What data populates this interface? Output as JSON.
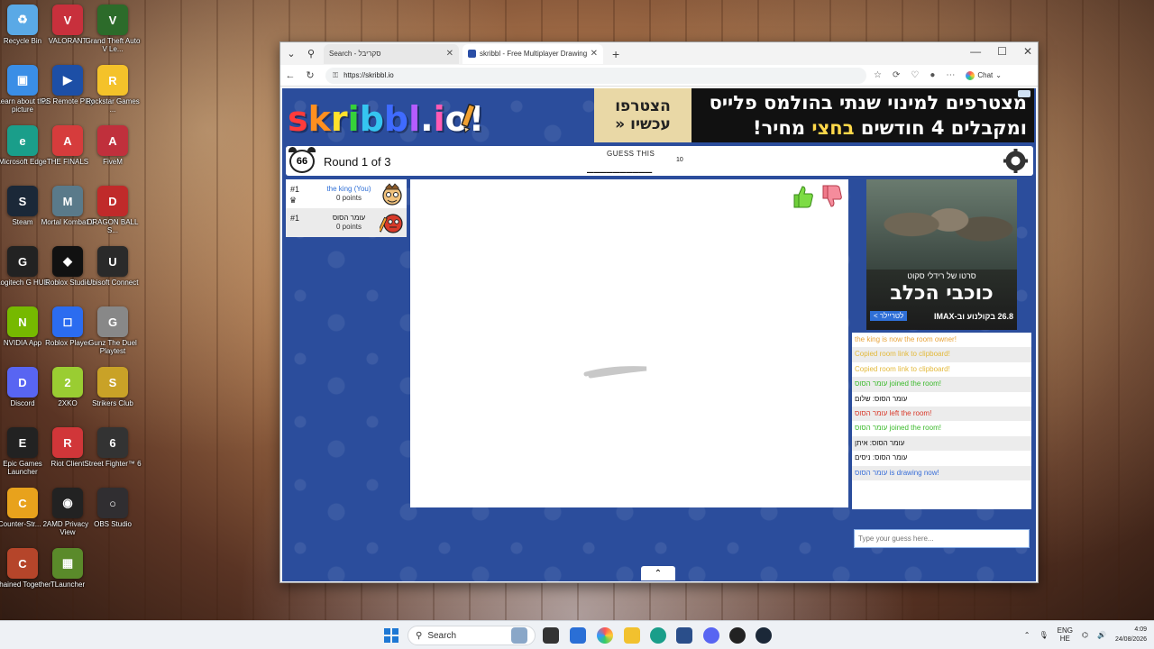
{
  "desktop": {
    "icons": [
      {
        "label": "Recycle Bin",
        "icon": "recycle-bin-icon",
        "color": "#5aa9e6",
        "glyph": "♻"
      },
      {
        "label": "VALORANT",
        "icon": "valorant-icon",
        "color": "#c8303c",
        "glyph": "V"
      },
      {
        "label": "Grand Theft Auto V Le...",
        "icon": "gta-icon",
        "color": "#2c6b2a",
        "glyph": "V"
      },
      {
        "label": "Learn about this picture",
        "icon": "learn-picture-icon",
        "color": "#3a8ee6",
        "glyph": "▣"
      },
      {
        "label": "PS Remote Play",
        "icon": "ps-remote-play-icon",
        "color": "#1d4fa6",
        "glyph": "▶"
      },
      {
        "label": "Rockstar Games ...",
        "icon": "rockstar-icon",
        "color": "#f4c22a",
        "glyph": "R"
      },
      {
        "label": "Microsoft Edge",
        "icon": "edge-icon",
        "color": "#1a9e8a",
        "glyph": "e"
      },
      {
        "label": "THE FINALS",
        "icon": "the-finals-icon",
        "color": "#d63c3c",
        "glyph": "A"
      },
      {
        "label": "FiveM",
        "icon": "fivem-icon",
        "color": "#c0303c",
        "glyph": "A"
      },
      {
        "label": "Steam",
        "icon": "steam-icon",
        "color": "#1b2838",
        "glyph": "S"
      },
      {
        "label": "Mortal Kombat 1",
        "icon": "mortal-kombat-icon",
        "color": "#5a7a8a",
        "glyph": "M"
      },
      {
        "label": "DRAGON BALL S...",
        "icon": "dragon-ball-icon",
        "color": "#c02a2a",
        "glyph": "D"
      },
      {
        "label": "Logitech G HUB",
        "icon": "logitech-icon",
        "color": "#222222",
        "glyph": "G"
      },
      {
        "label": "Roblox Studio",
        "icon": "roblox-studio-icon",
        "color": "#111111",
        "glyph": "◆"
      },
      {
        "label": "Ubisoft Connect",
        "icon": "ubisoft-icon",
        "color": "#2a2a2a",
        "glyph": "U"
      },
      {
        "label": "NVIDIA App",
        "icon": "nvidia-icon",
        "color": "#76b900",
        "glyph": "N"
      },
      {
        "label": "Roblox Player",
        "icon": "roblox-player-icon",
        "color": "#2b6cf0",
        "glyph": "◻"
      },
      {
        "label": "Gunz The Duel Playtest",
        "icon": "gunz-icon",
        "color": "#888888",
        "glyph": "G"
      },
      {
        "label": "Discord",
        "icon": "discord-icon",
        "color": "#5865f2",
        "glyph": "D"
      },
      {
        "label": "2XKO",
        "icon": "2xko-icon",
        "color": "#9acd32",
        "glyph": "2"
      },
      {
        "label": "Strikers Club",
        "icon": "strikers-club-icon",
        "color": "#c9a227",
        "glyph": "S"
      },
      {
        "label": "Epic Games Launcher",
        "icon": "epic-games-icon",
        "color": "#222222",
        "glyph": "E"
      },
      {
        "label": "Riot Client",
        "icon": "riot-client-icon",
        "color": "#d13639",
        "glyph": "R"
      },
      {
        "label": "Street Fighter™ 6",
        "icon": "street-fighter-icon",
        "color": "#333333",
        "glyph": "6"
      },
      {
        "label": "Counter-Str... 2",
        "icon": "counter-strike-icon",
        "color": "#e8a21c",
        "glyph": "C"
      },
      {
        "label": "AMD Privacy View",
        "icon": "amd-privacy-icon",
        "color": "#222222",
        "glyph": "◉"
      },
      {
        "label": "OBS Studio",
        "icon": "obs-icon",
        "color": "#302e31",
        "glyph": "○"
      },
      {
        "label": "Chained Together",
        "icon": "chained-together-icon",
        "color": "#b5452a",
        "glyph": "C"
      },
      {
        "label": "TLauncher",
        "icon": "tlauncher-icon",
        "color": "#5a8a2a",
        "glyph": "▦"
      }
    ]
  },
  "browser": {
    "tabs": [
      {
        "label": "Search - סקריבל"
      },
      {
        "label": "skribbl - Free Multiplayer Drawing"
      }
    ],
    "new_tab": "+",
    "url": "https://skribbl.io",
    "chat_label": "Chat",
    "controls": {
      "minimize": "—",
      "maximize": "☐",
      "close": "✕"
    }
  },
  "game": {
    "logo": [
      "s",
      "k",
      "r",
      "i",
      "b",
      "b",
      "l",
      ".",
      "i",
      "o",
      "!"
    ],
    "logo_colors": [
      "#ff3b3b",
      "#ff8f1f",
      "#ffe22b",
      "#36d13a",
      "#35c5f0",
      "#3f6bff",
      "#b45cff",
      "#ffffff",
      "#ff5ab4",
      "#ffffff",
      "#ffffff"
    ],
    "ad_banner": {
      "join_line1": "הצטרפו",
      "join_line2": "עכשיו",
      "join_arrow": "«",
      "line1": "מצטרפים למינוי שנתי בהולמס פלייס",
      "line2_a": "ומקבלים 4 חודשים",
      "line2_b": "בחצי",
      "line2_c": " מחיר!"
    },
    "timer": "66",
    "round": "Round 1 of 3",
    "guess_label": "GUESS THIS",
    "word_blank": "__________",
    "word_length": "10",
    "players": [
      {
        "rank": "#1",
        "name": "the king (You)",
        "points": "0 points",
        "owner": true
      },
      {
        "rank": "#1",
        "name": "עומר הסוס",
        "points": "0 points",
        "owner": false
      }
    ],
    "side_ad": {
      "line1": "סרטו של רידלי סקוט",
      "title": "כוכבי הכלב",
      "info": "26.8 בקולנוע וב-IMAX",
      "trailer": "לטריילר >"
    },
    "chat": [
      {
        "prefix": "",
        "text": "the king is now the room owner!",
        "color": "orange"
      },
      {
        "prefix": "",
        "text": "Copied room link to clipboard!",
        "color": "yellow"
      },
      {
        "prefix": "",
        "text": "Copied room link to clipboard!",
        "color": "yellow"
      },
      {
        "prefix": "עומר הסוס",
        "text": " joined the room!",
        "color": "green"
      },
      {
        "prefix": "עומר הסוס: ",
        "text": "שלום",
        "color": "black"
      },
      {
        "prefix": "עומר הסוס",
        "text": " left the room!",
        "color": "red"
      },
      {
        "prefix": "עומר הסוס",
        "text": " joined the room!",
        "color": "green"
      },
      {
        "prefix": "עומר הסוס: ",
        "text": "איתן",
        "color": "black"
      },
      {
        "prefix": "עומר הסוס: ",
        "text": "ניסים",
        "color": "black"
      },
      {
        "prefix": "עומר הסוס",
        "text": " is drawing now!",
        "color": "blue"
      }
    ],
    "chat_placeholder": "Type your guess here..."
  },
  "taskbar": {
    "search_label": "Search",
    "lang_top": "ENG",
    "lang_bottom": "HE",
    "time": "4:09",
    "date": "24/08/2026"
  }
}
